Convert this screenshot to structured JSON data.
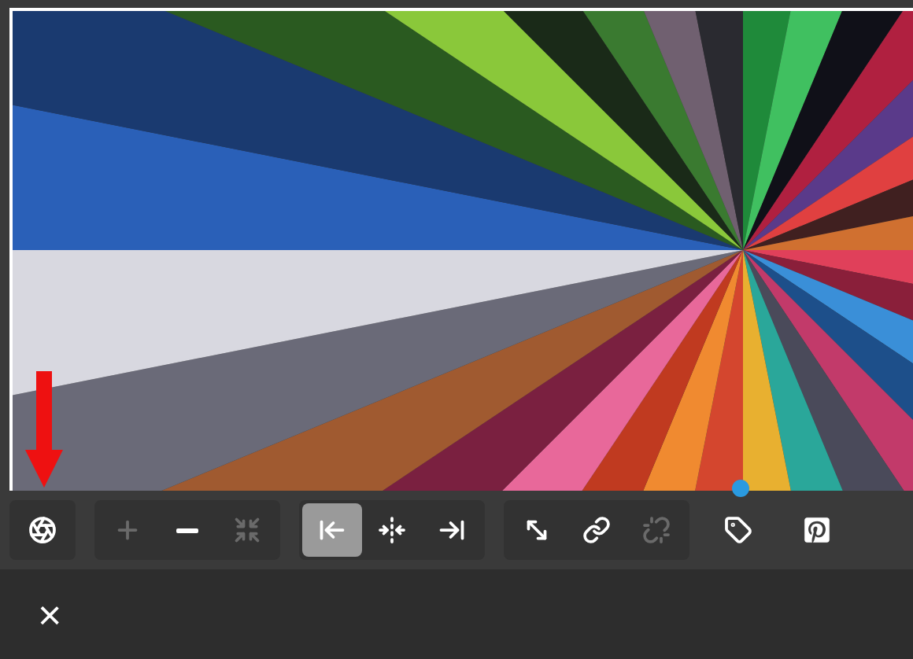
{
  "toolbar": {
    "groups": [
      {
        "framed": true,
        "buttons": [
          {
            "disabled": false,
            "selected": false
          }
        ]
      },
      {
        "framed": true,
        "buttons": [
          {
            "disabled": true,
            "selected": false
          },
          {
            "disabled": false,
            "selected": false
          },
          {
            "disabled": true,
            "selected": false
          }
        ]
      },
      {
        "framed": true,
        "buttons": [
          {
            "disabled": false,
            "selected": true
          },
          {
            "disabled": false,
            "selected": false
          },
          {
            "disabled": false,
            "selected": false
          }
        ]
      },
      {
        "framed": true,
        "buttons": [
          {
            "disabled": false,
            "selected": false
          },
          {
            "disabled": false,
            "selected": false
          },
          {
            "disabled": true,
            "selected": false
          }
        ]
      },
      {
        "framed": false,
        "buttons": [
          {
            "disabled": false,
            "selected": false
          },
          {
            "disabled": false,
            "selected": false
          }
        ]
      }
    ]
  },
  "close_label": "×"
}
